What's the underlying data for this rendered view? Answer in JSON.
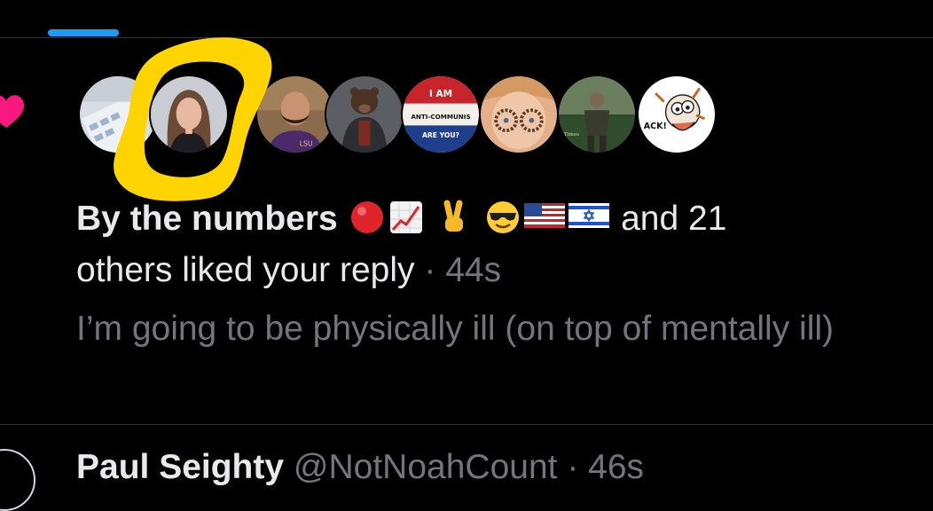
{
  "notification": {
    "liker_name": "By the numbers",
    "name_emojis": [
      "red-circle",
      "chart-increasing",
      "victory-hand",
      "smiling-face-with-sunglasses",
      "flag-us",
      "flag-israel"
    ],
    "and_text": "and 21",
    "others_text": "others liked your reply",
    "separator": "·",
    "time": "44s"
  },
  "reply": {
    "text": "I’m going to be physically ill (on top of mentally ill)"
  },
  "avatars": [
    {
      "name": "avatar-calculator"
    },
    {
      "name": "avatar-woman-brown-hair"
    },
    {
      "name": "avatar-man-beard"
    },
    {
      "name": "avatar-bear-armor"
    },
    {
      "name": "avatar-anti-communist-button",
      "text_lines": [
        "I AM",
        "ANTI-COMMUNIS",
        "ARE YOU?"
      ]
    },
    {
      "name": "avatar-woman-glasses"
    },
    {
      "name": "avatar-warrior-statue"
    },
    {
      "name": "avatar-cartoon-character",
      "text": "ACK!"
    }
  ],
  "next_item": {
    "name": "Paul Seighty",
    "handle": "@NotNoahCount · 46s"
  },
  "colors": {
    "background": "#000000",
    "text": "#e7e9ea",
    "muted": "#71767b",
    "accent": "#1d9bf0",
    "heart": "#f91880",
    "highlight": "#ffd400"
  }
}
